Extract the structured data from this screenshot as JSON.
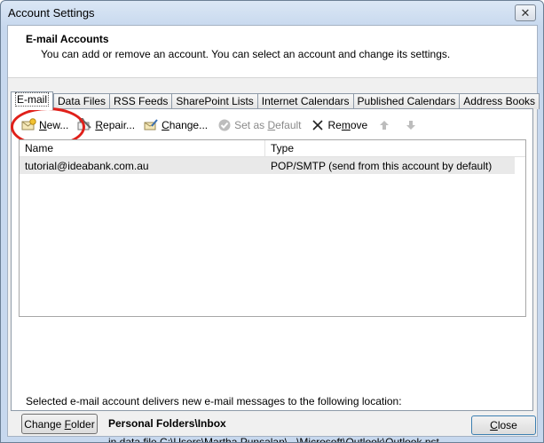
{
  "window": {
    "title": "Account Settings",
    "close_glyph": "✕"
  },
  "header": {
    "title": "E-mail Accounts",
    "subtitle": "You can add or remove an account. You can select an account and change its settings."
  },
  "tabs": [
    {
      "label": "E-mail",
      "active": true
    },
    {
      "label": "Data Files"
    },
    {
      "label": "RSS Feeds"
    },
    {
      "label": "SharePoint Lists"
    },
    {
      "label": "Internet Calendars"
    },
    {
      "label": "Published Calendars"
    },
    {
      "label": "Address Books"
    }
  ],
  "toolbar": {
    "new": {
      "pre": "",
      "accel": "N",
      "post": "ew...",
      "icon": "new-account-icon"
    },
    "repair": {
      "pre": "",
      "accel": "R",
      "post": "epair...",
      "icon": "repair-icon"
    },
    "change": {
      "pre": "",
      "accel": "C",
      "post": "hange...",
      "icon": "change-icon"
    },
    "set_default": {
      "pre": "Set as ",
      "accel": "D",
      "post": "efault",
      "icon": "checkmark-circle-icon"
    },
    "remove": {
      "pre": "Re",
      "accel": "m",
      "post": "ove",
      "icon": "x-icon"
    },
    "move_up_icon": "arrow-up-icon",
    "move_down_icon": "arrow-down-icon"
  },
  "accounts_table": {
    "columns": [
      "Name",
      "Type"
    ],
    "rows": [
      {
        "name": "tutorial@ideabank.com.au",
        "type": "POP/SMTP (send from this account by default)"
      }
    ]
  },
  "delivery": {
    "description": "Selected e-mail account delivers new e-mail messages to the following location:",
    "change_folder": {
      "pre": "Change ",
      "accel": "F",
      "post": "older"
    },
    "folder_name": "Personal Folders\\Inbox",
    "folder_path": "in data file C:\\Users\\Martha Punsalan\\...\\Microsoft\\Outlook\\Outlook.pst"
  },
  "footer": {
    "close": {
      "pre": "",
      "accel": "C",
      "post": "lose"
    }
  },
  "colors": {
    "highlight_ring": "#e0201a",
    "window_frame": "#c7d8ee",
    "selected_row": "#e9e9e9"
  }
}
